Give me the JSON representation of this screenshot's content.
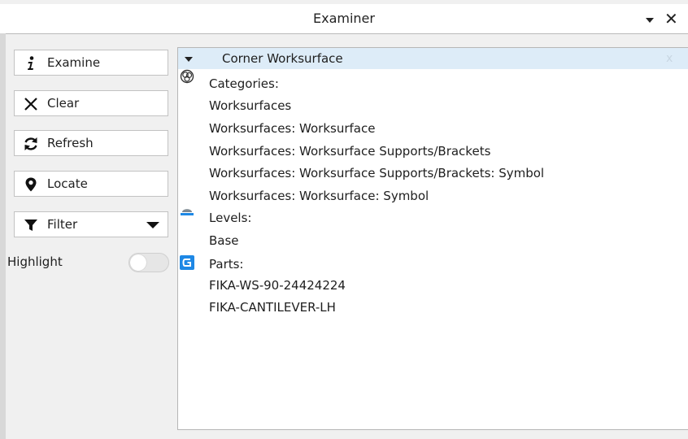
{
  "window": {
    "title": "Examiner",
    "close_glyph": "✕",
    "menu_icon": "chevron-down-icon"
  },
  "sidebar": {
    "buttons": [
      {
        "label": "Examine",
        "icon": "info-icon"
      },
      {
        "label": "Clear",
        "icon": "close-icon"
      },
      {
        "label": "Refresh",
        "icon": "refresh-icon"
      },
      {
        "label": "Locate",
        "icon": "map-pin-icon"
      },
      {
        "label": "Filter",
        "icon": "filter-icon"
      }
    ],
    "highlight": {
      "label": "Highlight",
      "on": false
    }
  },
  "examiner": {
    "selection": {
      "name": "Corner Worksurface",
      "close_glyph": "x"
    },
    "categories": {
      "label": "Categories:",
      "icon": "categories-icon",
      "items": [
        "Worksurfaces",
        "Worksurfaces: Worksurface",
        "Worksurfaces: Worksurface Supports/Brackets",
        "Worksurfaces: Worksurface Supports/Brackets: Symbol",
        "Worksurfaces: Worksurface: Symbol"
      ]
    },
    "levels": {
      "label": "Levels:",
      "icon": "level-icon",
      "items": [
        "Base"
      ]
    },
    "parts": {
      "label": "Parts:",
      "icon": "parts-app-icon",
      "items": [
        "FIKA-WS-90-24424224",
        "FIKA-CANTILEVER-LH"
      ]
    }
  },
  "colors": {
    "panel_bg": "#f0f0f0",
    "selection_bg": "#ddecf8",
    "parts_icon": "#1e88e5"
  }
}
